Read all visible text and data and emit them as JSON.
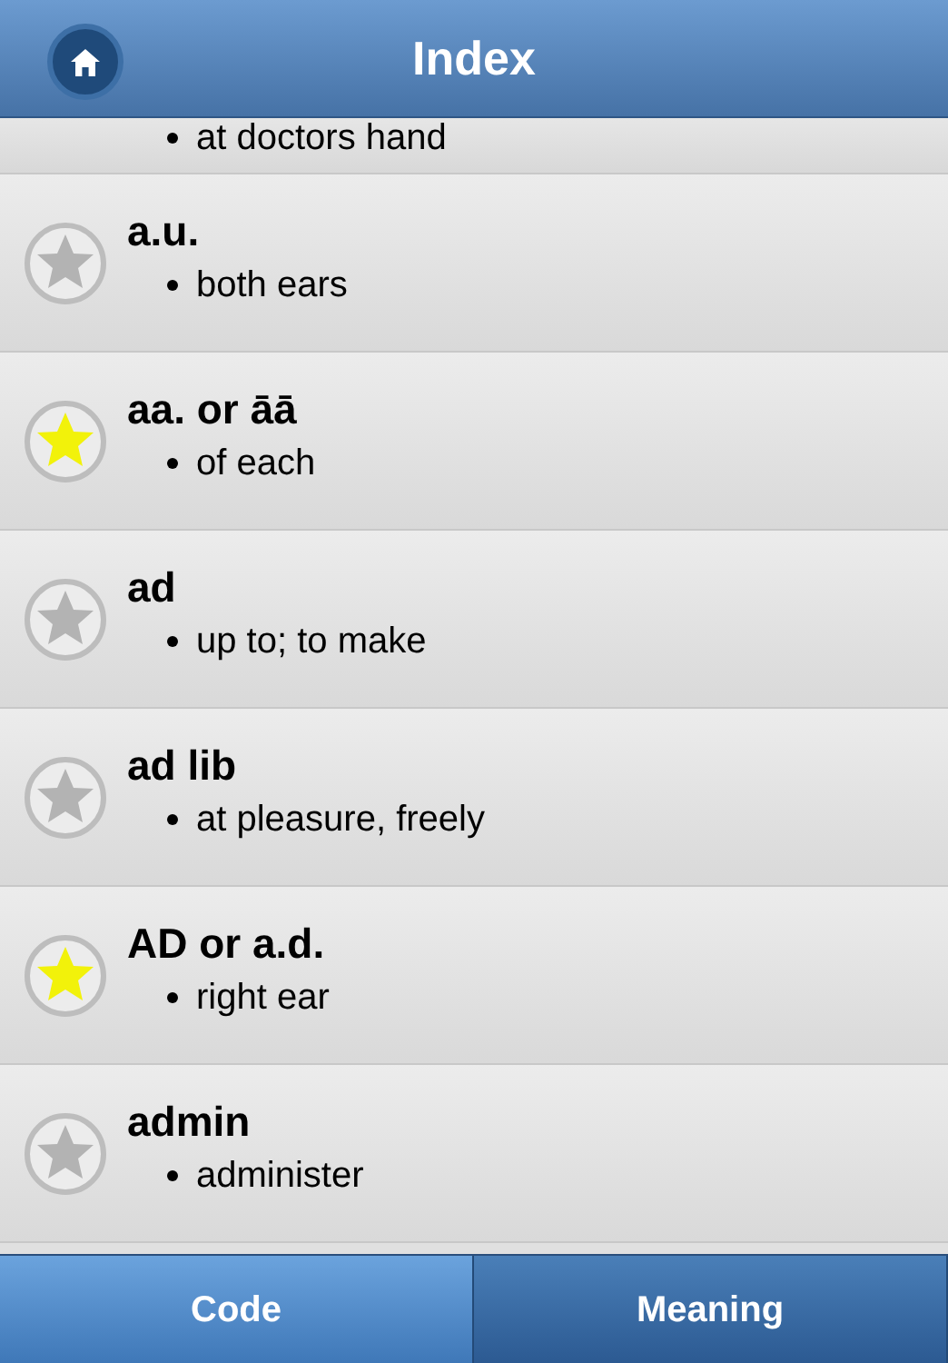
{
  "header": {
    "title": "Index"
  },
  "partial_entry": {
    "meaning": "at doctors hand"
  },
  "entries": [
    {
      "code": "a.u.",
      "meaning": "both ears",
      "starred": false
    },
    {
      "code": "aa. or āā",
      "meaning": "of each",
      "starred": true
    },
    {
      "code": "ad",
      "meaning": "up to; to make",
      "starred": false
    },
    {
      "code": "ad lib",
      "meaning": "at pleasure, freely",
      "starred": false
    },
    {
      "code": "AD or a.d.",
      "meaning": "right ear",
      "starred": true
    },
    {
      "code": "admin",
      "meaning": "administer",
      "starred": false
    }
  ],
  "tabs": [
    {
      "label": "Code",
      "selected": true
    },
    {
      "label": "Meaning",
      "selected": false
    }
  ]
}
